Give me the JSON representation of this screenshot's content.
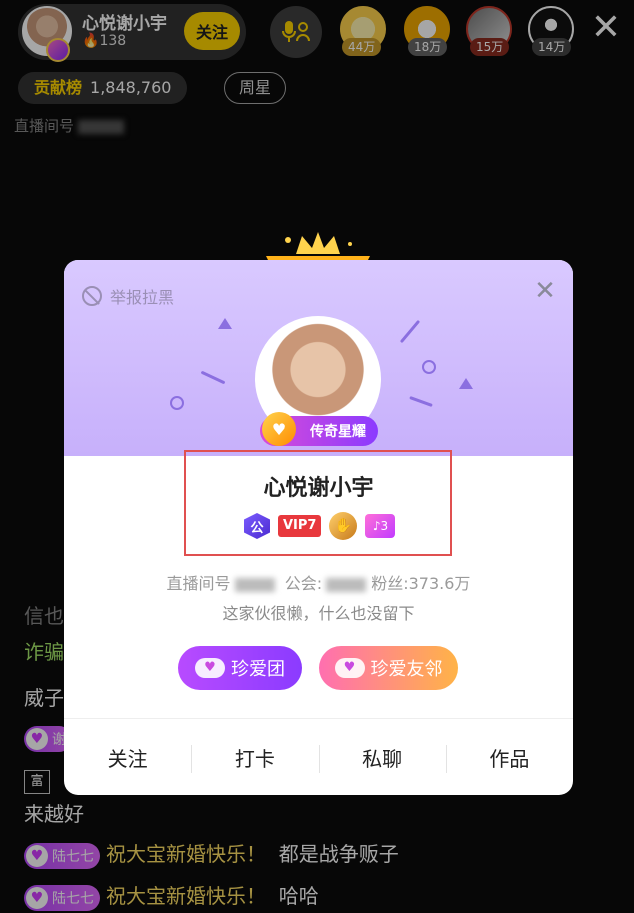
{
  "header": {
    "host_name": "心悦谢小宇",
    "heat": "138",
    "follow_label": "关注",
    "viewers": [
      {
        "count": "44万",
        "color": "#ffd34d"
      },
      {
        "count": "18万",
        "color": "#f2a900"
      },
      {
        "count": "15万",
        "color": "#c0392b"
      },
      {
        "count": "14万",
        "color": "#2c2c2c"
      }
    ],
    "rank_label": "贡献榜",
    "rank_value": "1,848,760",
    "week_star": "周星",
    "room_label": "直播间号"
  },
  "chat": {
    "fragments": [
      "信也",
      "诈骗",
      "威子"
    ],
    "line_tail": "来越好",
    "badge_user_1": "谢",
    "badge_rich": "富",
    "messages": [
      {
        "user": "陆七七",
        "text": "祝大宝新婚快乐！",
        "reply": "都是战争贩子"
      },
      {
        "user": "陆七七",
        "text": "祝大宝新婚快乐！",
        "reply": "哈哈"
      }
    ]
  },
  "card": {
    "report_label": "举报拉黑",
    "title_badge": "传奇星耀",
    "name": "心悦谢小宇",
    "badges": {
      "gong": "公",
      "vip": "VIP7",
      "level": "3"
    },
    "room_label": "直播间号",
    "guild_label": "公会:",
    "fans_label": "粉丝:373.6万",
    "bio": "这家伙很懒，什么也没留下",
    "fan_group_1": "珍爱团",
    "fan_group_2": "珍爱友邻",
    "actions": [
      "关注",
      "打卡",
      "私聊",
      "作品"
    ]
  }
}
